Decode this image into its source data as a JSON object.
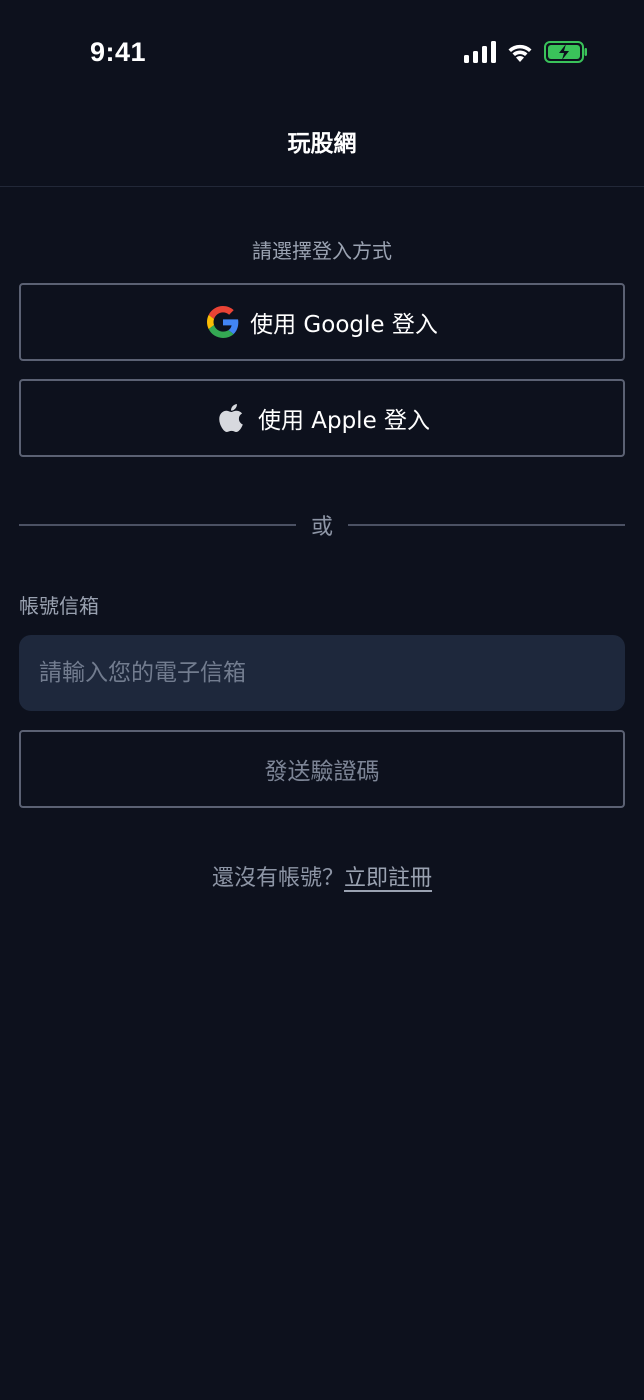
{
  "status_bar": {
    "time": "9:41",
    "icons": [
      "signal-icon",
      "wifi-icon",
      "battery-charging-icon"
    ]
  },
  "header": {
    "title": "玩股網"
  },
  "login": {
    "prompt": "請選擇登入方式",
    "google_button": {
      "label": "使用 Google 登入",
      "icon": "google-icon"
    },
    "apple_button": {
      "label": "使用 Apple 登入",
      "icon": "apple-icon"
    },
    "divider_text": "或",
    "email_label": "帳號信箱",
    "email_placeholder": "請輸入您的電子信箱",
    "email_value": "",
    "send_code_label": "發送驗證碼",
    "signup_prompt": "還沒有帳號？",
    "signup_link": "立即註冊"
  },
  "colors": {
    "background": "#0d111d",
    "input_background": "#1e283c",
    "border": "#5b6173",
    "battery_green": "#3ac35a"
  }
}
